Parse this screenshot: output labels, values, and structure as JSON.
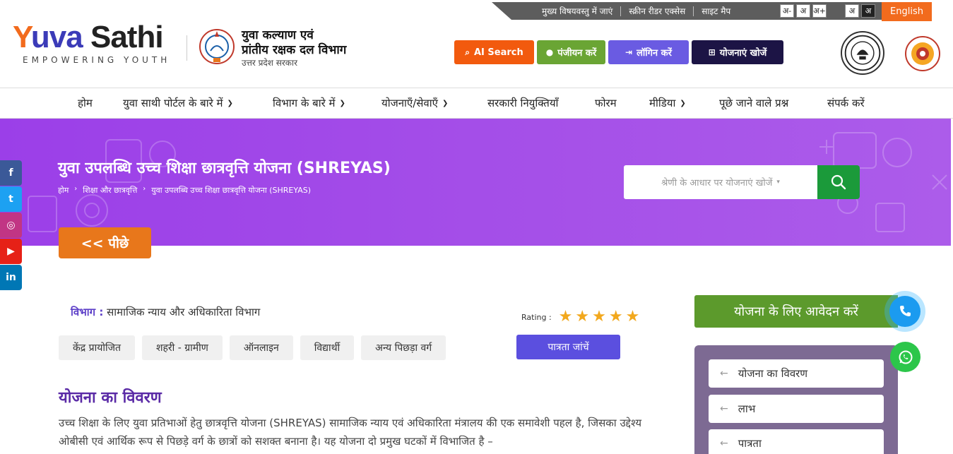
{
  "topbar": {
    "links": [
      "मुख्य विषयवस्तु में जाएं",
      "स्क्रीन रीडर एक्सेस",
      "साइट मैप"
    ],
    "font_sizes": [
      "अ-",
      "अ",
      "अ+"
    ],
    "contrast": [
      "अ",
      "अ"
    ],
    "language": "English"
  },
  "header": {
    "logo_part1": "Y",
    "logo_part2": "uva",
    "logo_part3": " Sathi",
    "logo_tagline": "EMPOWERING YOUTH",
    "dept_line1": "युवा कल्याण एवं",
    "dept_line2": "प्रांतीय रक्षक दल विभाग",
    "dept_line3": "उत्तर प्रदेश सरकार",
    "buttons": {
      "ai_search": "AI Search",
      "register": "पंजीयन करें",
      "login": "लॉगिन करें",
      "find_schemes": "योजनाएं खोजें"
    },
    "colors": {
      "orange": "#f25a0e",
      "green": "#6aa534",
      "purple": "#6a5be2",
      "navy": "#1c1445"
    }
  },
  "nav": {
    "items": [
      {
        "label": "होम",
        "dropdown": false
      },
      {
        "label": "युवा साथी पोर्टल के बारे में",
        "dropdown": true
      },
      {
        "label": "विभाग के बारे में",
        "dropdown": true
      },
      {
        "label": "योजनाएँ/सेवाएँ",
        "dropdown": true
      },
      {
        "label": "सरकारी नियुक्तियाँ",
        "dropdown": false
      },
      {
        "label": "फोरम",
        "dropdown": false
      },
      {
        "label": "मीडिया",
        "dropdown": true
      },
      {
        "label": "पूछे जाने वाले प्रश्न",
        "dropdown": false
      },
      {
        "label": "संपर्क करें",
        "dropdown": false
      }
    ]
  },
  "banner": {
    "title": "युवा उपलब्धि उच्च शिक्षा छात्रवृत्ति योजना (SHREYAS)",
    "breadcrumb": [
      "होम",
      "शिक्षा और छात्रवृत्ति",
      "युवा उपलब्धि उच्च शिक्षा छात्रवृत्ति योजना (SHREYAS)"
    ],
    "search_placeholder": "श्रेणी के आधार पर योजनाएं खोजें",
    "back_label": "<< पीछे"
  },
  "social": [
    {
      "name": "facebook",
      "glyph": "f",
      "color": "#3b5998"
    },
    {
      "name": "twitter",
      "glyph": "t",
      "color": "#1da1f2"
    },
    {
      "name": "instagram",
      "glyph": "◎",
      "color": "#c13584"
    },
    {
      "name": "youtube",
      "glyph": "▶",
      "color": "#e62117"
    },
    {
      "name": "linkedin",
      "glyph": "in",
      "color": "#0077b5"
    }
  ],
  "scheme": {
    "dept_label": "विभाग :",
    "dept_value": "सामाजिक न्याय और अधिकारिता विभाग",
    "rating_label": "Rating :",
    "rating_value": 5,
    "tags": [
      "केंद्र प्रायोजित",
      "शहरी - ग्रामीण",
      "ऑनलाइन",
      "विद्यार्थी",
      "अन्य पिछड़ा वर्ग"
    ],
    "eligibility_button": "पात्रता जांचें",
    "section_title": "योजना का विवरण",
    "description": "उच्च शिक्षा के लिए युवा प्रतिभाओं हेतु छात्रवृत्ति योजना (SHREYAS) सामाजिक न्याय एवं अधिकारिता मंत्रालय की एक समावेशी पहल है, जिसका उद्देश्य ओबीसी एवं आर्थिक रूप से पिछड़े वर्ग के छात्रों को सशक्त बनाना है। यह योजना दो प्रमुख घटकों में विभाजित है –"
  },
  "sidebar": {
    "apply_button": "योजना के लिए आवेदन करें",
    "links": [
      "योजना का विवरण",
      "लाभ",
      "पात्रता"
    ]
  }
}
